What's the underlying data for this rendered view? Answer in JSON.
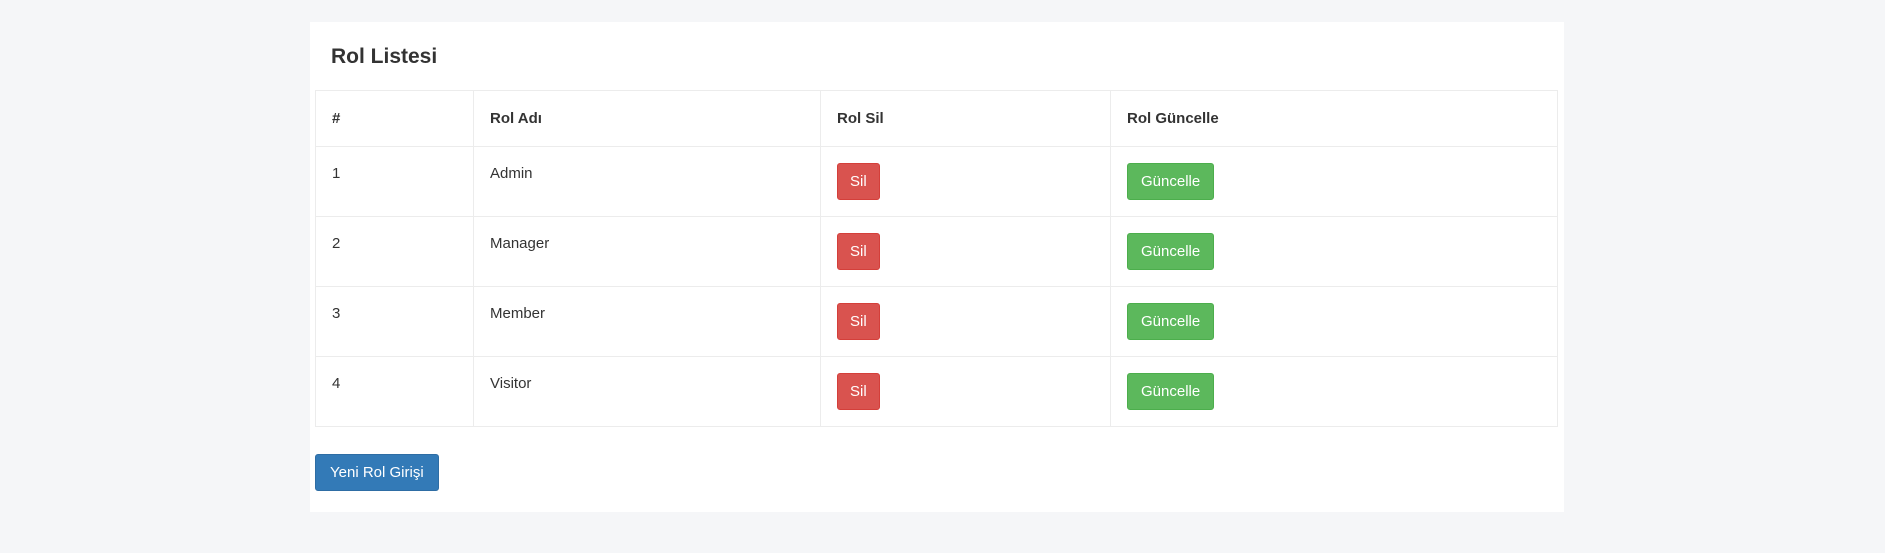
{
  "page": {
    "title": "Rol Listesi"
  },
  "table": {
    "headers": {
      "index": "#",
      "name": "Rol Adı",
      "delete": "Rol Sil",
      "update": "Rol Güncelle"
    },
    "rows": [
      {
        "index": "1",
        "name": "Admin",
        "delete_label": "Sil",
        "update_label": "Güncelle"
      },
      {
        "index": "2",
        "name": "Manager",
        "delete_label": "Sil",
        "update_label": "Güncelle"
      },
      {
        "index": "3",
        "name": "Member",
        "delete_label": "Sil",
        "update_label": "Güncelle"
      },
      {
        "index": "4",
        "name": "Visitor",
        "delete_label": "Sil",
        "update_label": "Güncelle"
      }
    ]
  },
  "actions": {
    "new_role_label": "Yeni Rol Girişi"
  },
  "colors": {
    "danger": "#d9534f",
    "success": "#5cb85c",
    "primary": "#337ab7",
    "page_background": "#f5f6f8"
  }
}
